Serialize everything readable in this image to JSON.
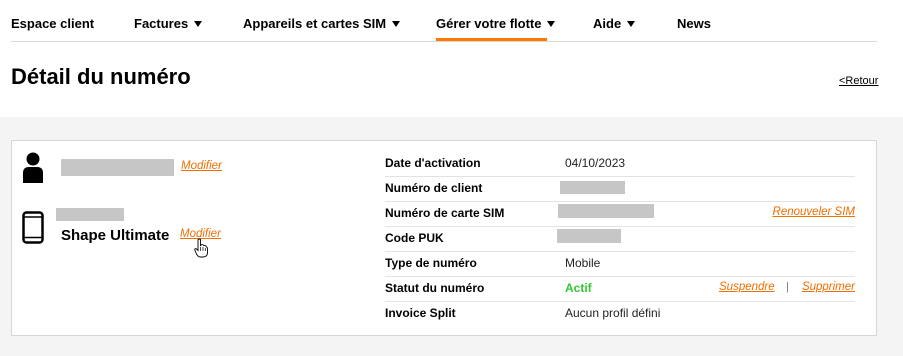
{
  "nav": {
    "items": [
      {
        "label": "Espace client"
      },
      {
        "label": "Factures"
      },
      {
        "label": "Appareils et cartes SIM"
      },
      {
        "label": "Gérer votre flotte"
      },
      {
        "label": "Aide"
      },
      {
        "label": "News"
      }
    ],
    "active": "Gérer votre flotte"
  },
  "header": {
    "title": "Détail du numéro",
    "back_label": "<Retour"
  },
  "user_panel": {
    "user_modify_label": "Modifier",
    "device_name": "Shape Ultimate",
    "device_modify_label": "Modifier"
  },
  "details": {
    "rows": [
      {
        "label": "Date d'activation",
        "value": "04/10/2023"
      },
      {
        "label": "Numéro de client",
        "value": ""
      },
      {
        "label": "Numéro de carte SIM",
        "value": "",
        "action": "Renouveler SIM"
      },
      {
        "label": "Code PUK",
        "value": ""
      },
      {
        "label": "Type de numéro",
        "value": "Mobile"
      },
      {
        "label": "Statut du numéro",
        "value": "Actif",
        "action": "Suspendre",
        "separator": "|",
        "action2": "Supprimer"
      },
      {
        "label": "Invoice Split",
        "value": "Aucun profil défini"
      }
    ]
  },
  "colors": {
    "accent": "#ff7900",
    "link": "#f16e00",
    "active_status": "#32c832",
    "band": "#f4f4f4"
  },
  "icons": {
    "user": "person-icon",
    "device": "smartphone-icon",
    "dropdown": "caret-down-icon",
    "cursor": "hand-pointer-icon"
  }
}
